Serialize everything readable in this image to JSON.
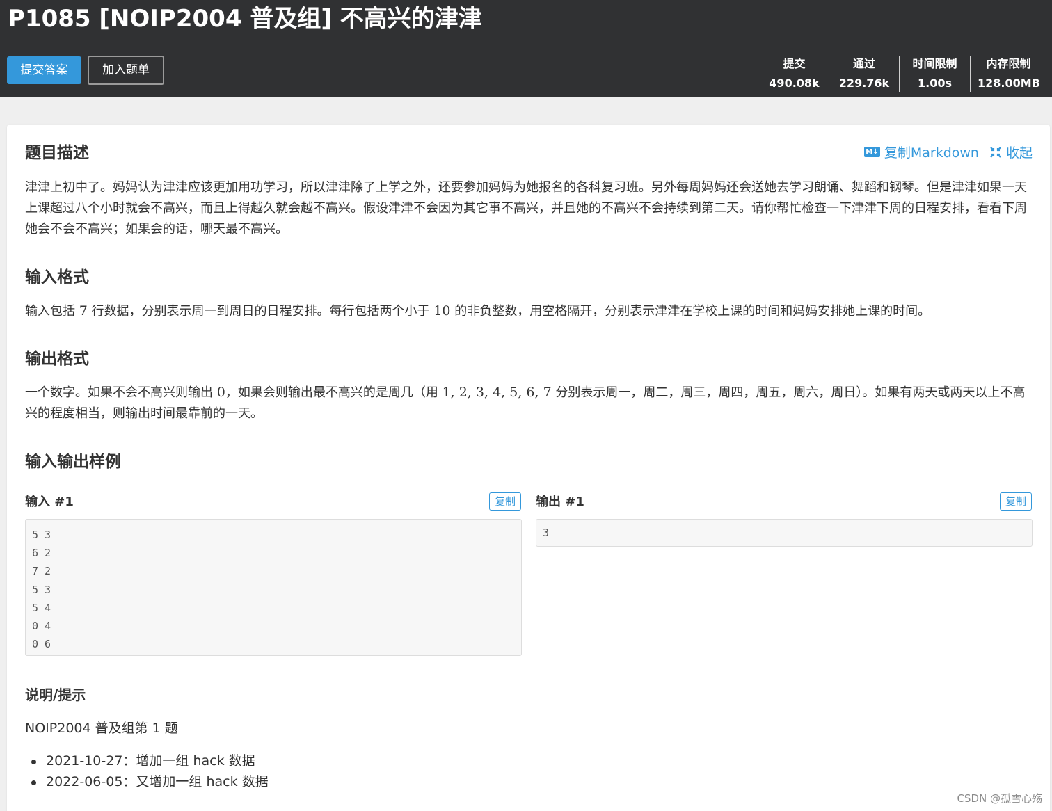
{
  "header": {
    "title": "P1085 [NOIP2004 普及组] 不高兴的津津",
    "submit_label": "提交答案",
    "add_to_list_label": "加入题单",
    "stats": [
      {
        "label": "提交",
        "value": "490.08k"
      },
      {
        "label": "通过",
        "value": "229.76k"
      },
      {
        "label": "时间限制",
        "value": "1.00s"
      },
      {
        "label": "内存限制",
        "value": "128.00MB"
      }
    ]
  },
  "toolbar": {
    "md_icon": "M↓",
    "copy_markdown": "复制Markdown",
    "collapse": "收起"
  },
  "sections": {
    "description": {
      "title": "题目描述",
      "text": "津津上初中了。妈妈认为津津应该更加用功学习，所以津津除了上学之外，还要参加妈妈为她报名的各科复习班。另外每周妈妈还会送她去学习朗诵、舞蹈和钢琴。但是津津如果一天上课超过八个小时就会不高兴，而且上得越久就会越不高兴。假设津津不会因为其它事不高兴，并且她的不高兴不会持续到第二天。请你帮忙检查一下津津下周的日程安排，看看下周她会不会不高兴；如果会的话，哪天最不高兴。"
    },
    "input_format": {
      "title": "输入格式",
      "text_a": "输入包括 ",
      "num_a": "7",
      "text_b": " 行数据，分别表示周一到周日的日程安排。每行包括两个小于 ",
      "num_b": "10",
      "text_c": " 的非负整数，用空格隔开，分别表示津津在学校上课的时间和妈妈安排她上课的时间。"
    },
    "output_format": {
      "title": "输出格式",
      "text_a": "一个数字。如果不会不高兴则输出 ",
      "num_a": "0",
      "text_b": "，如果会则输出最不高兴的是周几（用 ",
      "num_b": "1, 2, 3, 4, 5, 6, 7",
      "text_c": " 分别表示周一，周二，周三，周四，周五，周六，周日）。如果有两天或两天以上不高兴的程度相当，则输出时间最靠前的一天。"
    },
    "samples": {
      "title": "输入输出样例",
      "input_label": "输入 #1",
      "output_label": "输出 #1",
      "copy_label": "复制",
      "input_lines": [
        "5 3",
        "6 2",
        "7 2",
        "5 3",
        "5 4",
        "0 4",
        "0 6"
      ],
      "output_lines": [
        "3"
      ]
    },
    "hint": {
      "title": "说明/提示",
      "text": "NOIP2004 普及组第 1 题",
      "items": [
        "2021-10-27：增加一组 hack 数据",
        "2022-06-05：又增加一组 hack 数据"
      ]
    }
  },
  "watermark": "CSDN @孤雪心殇",
  "colors": {
    "header_bg": "#303133",
    "accent": "#3498db",
    "page_bg": "#efefef"
  }
}
